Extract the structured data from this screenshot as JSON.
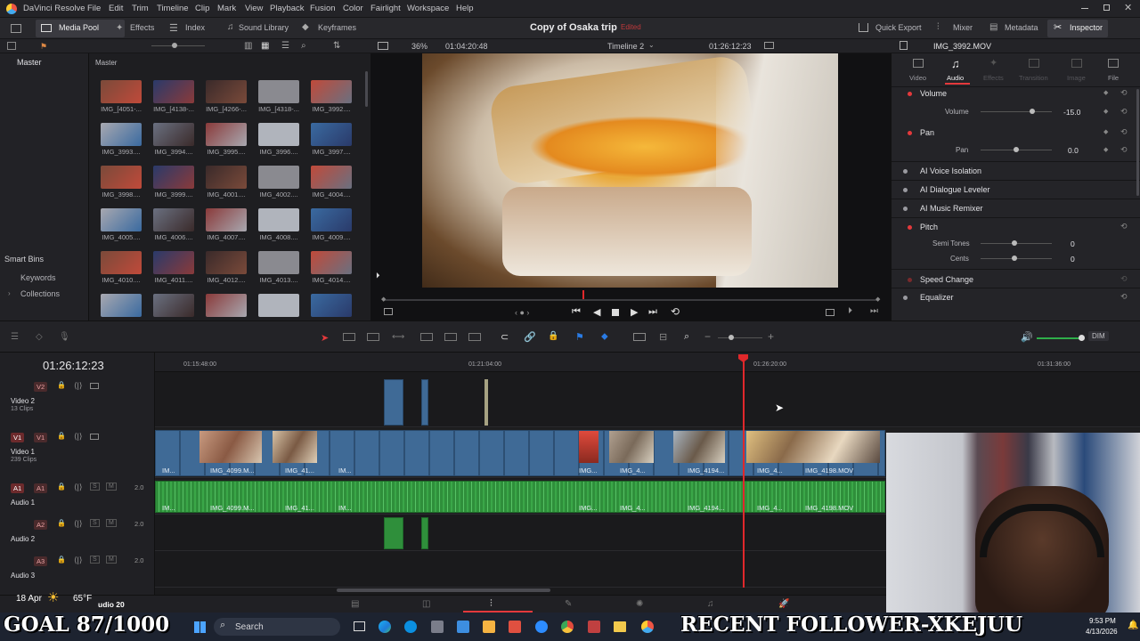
{
  "titlebar": {
    "app": "DaVinci Resolve",
    "menus": [
      "File",
      "Edit",
      "Trim",
      "Timeline",
      "Clip",
      "Mark",
      "View",
      "Playback",
      "Fusion",
      "Color",
      "Fairlight",
      "Workspace",
      "Help"
    ]
  },
  "toolbar": {
    "media_pool": "Media Pool",
    "effects": "Effects",
    "index": "Index",
    "sound_library": "Sound Library",
    "keyframes": "Keyframes",
    "project_title": "Copy of Osaka trip",
    "project_status": "Edited",
    "quick_export": "Quick Export",
    "mixer": "Mixer",
    "metadata": "Metadata",
    "inspector": "Inspector"
  },
  "subbar": {
    "zoom": "36%",
    "source_timecode": "01:04:20:48",
    "timeline_name": "Timeline 2",
    "record_timecode": "01:26:12:23",
    "clip_name": "IMG_3992.MOV"
  },
  "bins": {
    "master": "Master",
    "pool_header": "Master",
    "smart_bins": "Smart Bins",
    "keywords": "Keywords",
    "collections": "Collections"
  },
  "media": [
    "IMG_[4051-...",
    "IMG_[4138-...",
    "IMG_[4266-...",
    "IMG_[4318-...",
    "IMG_3992....",
    "IMG_3993....",
    "IMG_3994....",
    "IMG_3995....",
    "IMG_3996....",
    "IMG_3997....",
    "IMG_3998....",
    "IMG_3999....",
    "IMG_4001....",
    "IMG_4002....",
    "IMG_4004....",
    "IMG_4005....",
    "IMG_4006....",
    "IMG_4007....",
    "IMG_4008....",
    "IMG_4009....",
    "IMG_4010....",
    "IMG_4011....",
    "IMG_4012....",
    "IMG_4013....",
    "IMG_4014....",
    "",
    "",
    "",
    "",
    ""
  ],
  "inspector": {
    "tabs": [
      "Video",
      "Audio",
      "Effects",
      "Transition",
      "Image",
      "File"
    ],
    "volume_section": "Volume",
    "volume_label": "Volume",
    "volume_value": "-15.0",
    "volume_level": 0.72,
    "pan_section": "Pan",
    "pan_label": "Pan",
    "pan_value": "0.0",
    "pan_level": 0.5,
    "ai_voice": "AI Voice Isolation",
    "ai_dialogue": "AI Dialogue Leveler",
    "ai_music": "AI Music Remixer",
    "pitch": "Pitch",
    "semi_tones_label": "Semi Tones",
    "semi_tones_value": "0",
    "cents_label": "Cents",
    "cents_value": "0",
    "speed_change": "Speed Change",
    "equalizer": "Equalizer"
  },
  "timeline": {
    "current_timecode": "01:26:12:23",
    "ruler": [
      "01:15:48:00",
      "01:21:04:00",
      "01:26:20:00",
      "01:31:36:00"
    ],
    "dim_label": "DIM",
    "tracks": {
      "v2": {
        "badge": "V2",
        "name": "Video 2",
        "clips": "13 Clips"
      },
      "v1": {
        "badge": "V1",
        "name": "Video 1",
        "clips": "239 Clips"
      },
      "a1": {
        "badge": "A1",
        "name": "Audio 1",
        "level": "2.0"
      },
      "a2": {
        "badge": "A2",
        "name": "Audio 2",
        "level": "2.0"
      },
      "a3": {
        "badge": "A3",
        "name": "Audio 3",
        "level": "2.0"
      }
    },
    "clip_labels": [
      "IM...",
      "IMG_4099.M...",
      "IMG_41...",
      "IM...",
      "IMG...",
      "IMG_4...",
      "IMG_4194...",
      "IMG_4...",
      "IMG_4198.MOV"
    ]
  },
  "pagebar": {
    "partial_label": "udio 20"
  },
  "taskbar": {
    "date": "18 Apr",
    "temperature": "65°F",
    "search_placeholder": "Search",
    "time": "9:53 PM",
    "date_full": "4/13/2026"
  },
  "overlay": {
    "goal": "GOAL 87/1000",
    "follower": "RECENT FOLLOWER-XKEJUU"
  },
  "colors": {
    "accent": "#e4393c",
    "video_clip": "#3f6a96",
    "audio_clip": "#2f8f3b",
    "playhead": "#e0282b"
  }
}
